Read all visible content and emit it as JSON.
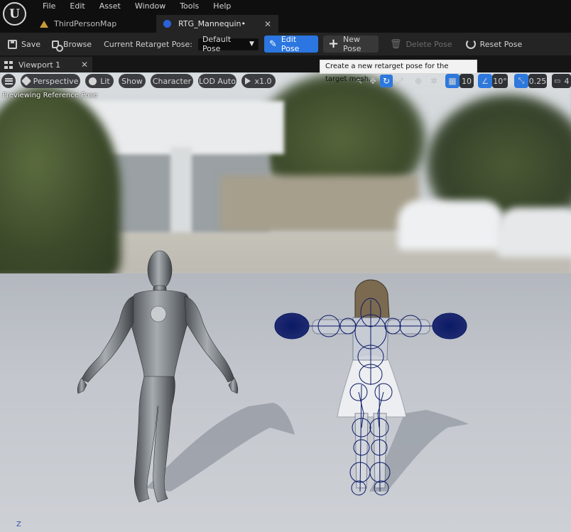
{
  "app": {
    "logo_text": "U",
    "menu": [
      "File",
      "Edit",
      "Asset",
      "Window",
      "Tools",
      "Help"
    ],
    "tabs": [
      {
        "label": "ThirdPersonMap",
        "active": false
      },
      {
        "label": "RTG_Mannequin•",
        "active": true
      }
    ],
    "tab_close_glyph": "✕"
  },
  "toolbar": {
    "save_label": "Save",
    "browse_label": "Browse",
    "current_pose_label": "Current Retarget Pose:",
    "current_pose_value": "Default Pose",
    "edit_pose_label": "Edit Pose",
    "new_pose_label": "New Pose",
    "delete_pose_label": "Delete Pose",
    "reset_pose_label": "Reset Pose"
  },
  "tooltip": {
    "text": "Create a new retarget pose for the target mesh."
  },
  "viewport_tab": {
    "label": "Viewport 1",
    "close_glyph": "✕"
  },
  "viewport": {
    "perspective_label": "Perspective",
    "lit_label": "Lit",
    "show_label": "Show",
    "character_label": "Character",
    "lod_label": "LOD Auto",
    "speed_label": "x1.0",
    "grid_snap_value": "10",
    "rotation_snap_value": "10°",
    "scale_snap_value": "0.25",
    "camera_count": "4",
    "caption": "Previewing Reference Pose",
    "axis_label": "Z"
  },
  "colors": {
    "accent_blue": "#2b76e0",
    "rtg_icon": "#2c61d8",
    "map_icon": "#c79a3a",
    "skeleton_wire": "#0b1a66"
  }
}
